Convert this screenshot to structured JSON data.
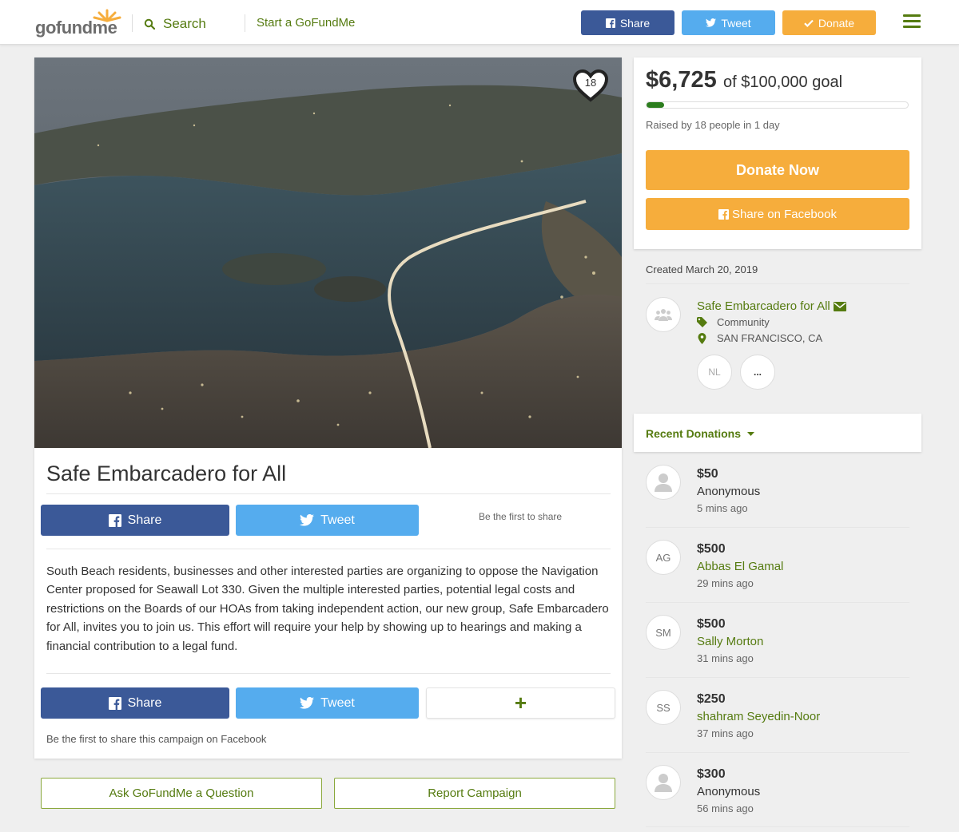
{
  "header": {
    "logo_go": "go",
    "logo_fund": "fund",
    "logo_me": "me",
    "search_label": "Search",
    "start_label": "Start a GoFundMe",
    "share_label": "Share",
    "tweet_label": "Tweet",
    "donate_label": "Donate",
    "colors": {
      "facebook": "#3b5998",
      "twitter": "#55acee",
      "donate": "#f6ad3c",
      "brand_green": "#557b10"
    }
  },
  "campaign": {
    "heart_count": "18",
    "title": "Safe Embarcadero for All",
    "share_label": "Share",
    "tweet_label": "Tweet",
    "first_share": "Be the first to share",
    "story": "South Beach residents, businesses and other interested parties are organizing to oppose the Navigation Center proposed for Seawall Lot 330.  Given the multiple interested parties, potential legal costs and restrictions on the Boards of our HOAs from taking independent action, our new group, Safe Embarcadero for All, invites you to join us.  This effort will require your help by showing up to hearings and making a financial contribution to a legal fund.",
    "more_label": "+",
    "fb_first": "Be the first to share this campaign on Facebook",
    "ask_label": "Ask GoFundMe a Question",
    "report_label": "Report Campaign"
  },
  "funding": {
    "raised": "$6,725",
    "goal": "of $100,000 goal",
    "progress_fraction": 0.067,
    "raised_by": "Raised by 18 people in 1 day",
    "donate_now": "Donate Now",
    "share_facebook": "Share on Facebook"
  },
  "organizer": {
    "created": "Created March 20, 2019",
    "name": "Safe Embarcadero for All",
    "category": "Community",
    "location": "SAN FRANCISCO, CA",
    "initials": "NL",
    "more": "..."
  },
  "donations": {
    "title": "Recent Donations",
    "items": [
      {
        "amount": "$50",
        "name": "Anonymous",
        "time": "5 mins ago",
        "initials": "",
        "link": false
      },
      {
        "amount": "$500",
        "name": "Abbas El Gamal",
        "time": "29 mins ago",
        "initials": "AG",
        "link": true
      },
      {
        "amount": "$500",
        "name": "Sally Morton",
        "time": "31 mins ago",
        "initials": "SM",
        "link": true
      },
      {
        "amount": "$250",
        "name": "shahram Seyedin-Noor",
        "time": "37 mins ago",
        "initials": "SS",
        "link": true
      },
      {
        "amount": "$300",
        "name": "Anonymous",
        "time": "56 mins ago",
        "initials": "",
        "link": false
      }
    ]
  }
}
